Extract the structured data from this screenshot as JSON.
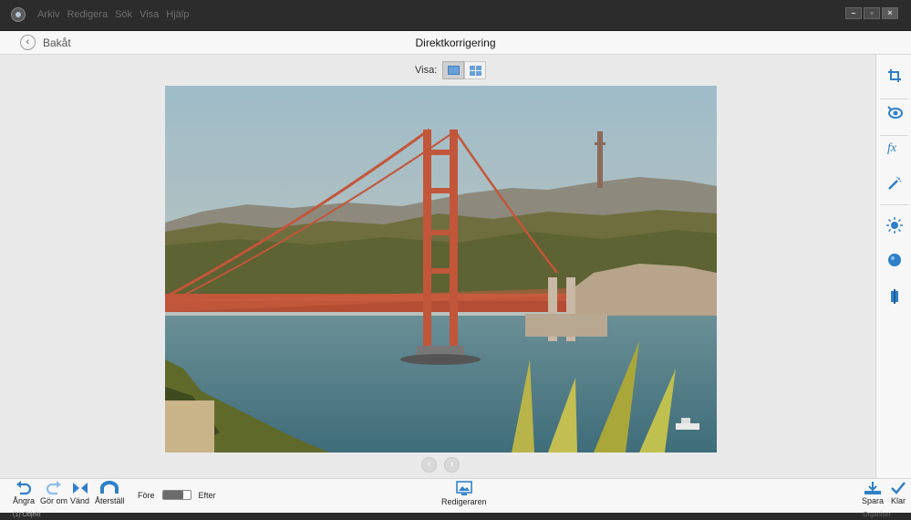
{
  "menu": [
    "Arkiv",
    "Redigera",
    "Sök",
    "Visa",
    "Hjälp"
  ],
  "window_controls": [
    "minimize-icon",
    "maximize-icon",
    "close-icon"
  ],
  "nav": {
    "back_label": "Bakåt",
    "title": "Direktkorrigering"
  },
  "view": {
    "label": "Visa:",
    "modes": [
      "single-view-icon",
      "before-after-view-icon"
    ],
    "active": "single-view-icon"
  },
  "photo": {
    "subject": "Golden Gate Bridge",
    "colors": {
      "sky": "#a9c3cc",
      "bridge": "#c2563a",
      "water": "#4f7b86",
      "foliage": "#8a8a32"
    }
  },
  "pager": [
    "previous-icon",
    "next-icon"
  ],
  "tools": [
    "crop-icon",
    "red-eye-icon",
    "effects-icon",
    "healing-icon",
    "lighting-icon",
    "color-icon",
    "sharpen-icon"
  ],
  "bottom": {
    "undo": "Ångra",
    "redo": "Gör om",
    "flip": "Vänd",
    "reset": "Återställ",
    "before": "Före",
    "after": "Efter",
    "editor": "Redigeraren",
    "save": "Spara",
    "done": "Klar"
  },
  "status": {
    "left": "(1) Objekt",
    "right": "Organiser"
  },
  "accent_color": "#2f80c8"
}
